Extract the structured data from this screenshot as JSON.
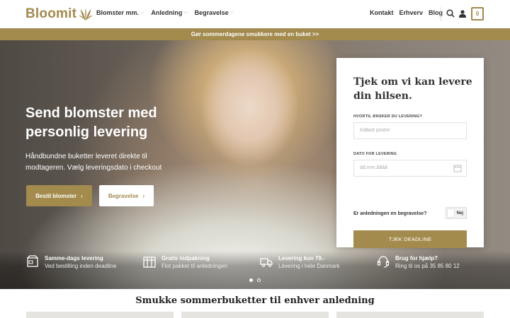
{
  "brand": {
    "name": "Bloomit"
  },
  "nav": {
    "left": [
      "Blomster mm.",
      "Anledning",
      "Begravelse"
    ],
    "right": [
      "Kontakt",
      "Erhverv",
      "Blog"
    ],
    "cart_count": "0"
  },
  "promo": {
    "text": "Gør sommerdagene smukkere med en buket >>"
  },
  "hero": {
    "title": "Send blomster med personlig levering",
    "subtitle": "Håndbundne buketter leveret direkte til modtageren. Vælg leveringsdato i checkout",
    "btn_primary": "Bestil blomster",
    "btn_secondary": "Begravelse"
  },
  "delivery_card": {
    "title": "Tjek om vi kan levere din hilsen.",
    "where_label": "HVORTIL ØNSKER DU LEVERING?",
    "where_placeholder": "Indtast postnr",
    "date_label": "DATO FOR LEVERING",
    "date_placeholder": "dd.mm.åååå",
    "funeral_question": "Er anledningen en begravelse?",
    "funeral_toggle": "Nej",
    "cta": "TJEK DEADLINE"
  },
  "features": [
    {
      "title": "Samme-dags levering",
      "sub": "Ved bestilling inden deadline",
      "icon": "package-icon"
    },
    {
      "title": "Gratis indpakning",
      "sub": "Flot pakket til anledningen",
      "icon": "gift-icon"
    },
    {
      "title": "Levering kun 79.-",
      "sub": "Levering i hele Danmark",
      "icon": "truck-icon"
    },
    {
      "title": "Brug for hjælp?",
      "sub": "Ring til os på 35 85 80 12",
      "icon": "headset-icon"
    }
  ],
  "slider": {
    "total": 2,
    "active": 1
  },
  "section": {
    "title": "Smukke sommerbuketter til enhver anledning"
  },
  "colors": {
    "accent": "#a38a4d"
  }
}
